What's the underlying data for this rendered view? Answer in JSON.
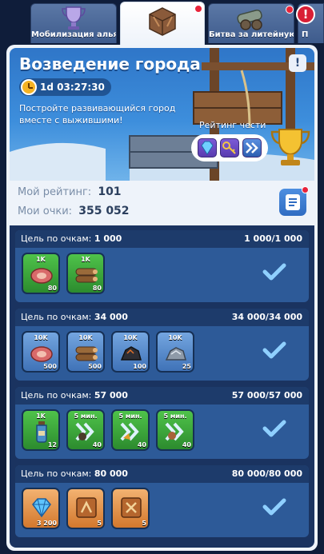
{
  "tabs": [
    {
      "label": "Мобилизация альянса"
    },
    {
      "label": ""
    },
    {
      "label": "Битва за литейную"
    },
    {
      "label": "П"
    }
  ],
  "event": {
    "title": "Возведение города",
    "timer": "1d 03:27:30",
    "description": "Постройте развивающийся город вместе с выжившими!",
    "honor_label": "Рейтинг чести"
  },
  "stats": {
    "rating_label": "Мой рейтинг:",
    "rating_value": "101",
    "points_label": "Мои очки:",
    "points_value": "355 052"
  },
  "milestones": [
    {
      "label": "Цель по очкам:",
      "target": "1 000",
      "progress": "1 000/1 000",
      "completed": true,
      "rewards": [
        {
          "icon": "meat-icon",
          "amount": "1K",
          "count": "80",
          "color": "green"
        },
        {
          "icon": "wood-icon",
          "amount": "1K",
          "count": "80",
          "color": "green"
        }
      ]
    },
    {
      "label": "Цель по очкам:",
      "target": "34 000",
      "progress": "34 000/34 000",
      "completed": true,
      "rewards": [
        {
          "icon": "meat-icon",
          "amount": "10K",
          "count": "500",
          "color": "blue"
        },
        {
          "icon": "wood-icon",
          "amount": "10K",
          "count": "500",
          "color": "blue"
        },
        {
          "icon": "coal-icon",
          "amount": "10K",
          "count": "100",
          "color": "blue"
        },
        {
          "icon": "iron-icon",
          "amount": "10K",
          "count": "25",
          "color": "blue"
        }
      ]
    },
    {
      "label": "Цель по очкам:",
      "target": "57 000",
      "progress": "57 000/57 000",
      "completed": true,
      "rewards": [
        {
          "icon": "water-bottle-icon",
          "amount": "1K",
          "count": "12",
          "color": "green"
        },
        {
          "icon": "speedup-icon",
          "amount": "5 мин.",
          "count": "40",
          "color": "green"
        },
        {
          "icon": "speedup-icon",
          "amount": "5 мин.",
          "count": "40",
          "color": "green"
        },
        {
          "icon": "speedup-icon",
          "amount": "5 мин.",
          "count": "40",
          "color": "green"
        }
      ]
    },
    {
      "label": "Цель по очкам:",
      "target": "80 000",
      "progress": "80 000/80 000",
      "completed": true,
      "rewards": [
        {
          "icon": "gem-icon",
          "amount": "",
          "count": "3 200",
          "color": "orange"
        },
        {
          "icon": "book-icon",
          "amount": "",
          "count": "5",
          "color": "orange"
        },
        {
          "icon": "book-icon",
          "amount": "",
          "count": "5",
          "color": "orange"
        }
      ]
    }
  ],
  "colors": {
    "accent": "#2f6cc2",
    "alert": "#e8233a",
    "check": "#8fd0ff"
  }
}
